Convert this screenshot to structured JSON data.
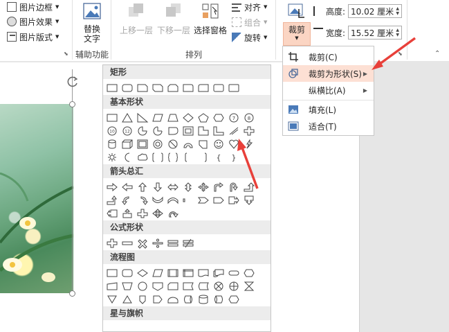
{
  "ribbon": {
    "picture_styles": [
      "图片边框",
      "图片效果",
      "图片版式"
    ],
    "alt_text_label": "替换\n文字",
    "aux_group_label": "辅助功能",
    "bring_forward": "上移一层",
    "send_backward": "下移一层",
    "selection_pane": "选择窗格",
    "align": "对齐",
    "group": "组合",
    "rotate": "旋转",
    "arrange_group_label": "排列",
    "crop_label": "裁剪",
    "height_label": "高度:",
    "height_value": "10.02 厘米",
    "width_label": "宽度:",
    "width_value": "15.52 厘米"
  },
  "crop_menu": {
    "items": [
      {
        "label": "裁剪(C)",
        "icon": "crop-icon"
      },
      {
        "label": "裁剪为形状(S)",
        "icon": "crop-to-shape-icon",
        "submenu": true
      },
      {
        "label": "纵横比(A)",
        "icon": "",
        "submenu": true
      },
      {
        "label": "填充(L)",
        "icon": "fill-icon"
      },
      {
        "label": "适合(T)",
        "icon": "fit-icon"
      }
    ]
  },
  "gallery": {
    "categories": [
      "矩形",
      "基本形状",
      "箭头总汇",
      "公式形状",
      "流程图",
      "星与旗帜"
    ],
    "number_shapes": [
      "7",
      "8",
      "10",
      "12"
    ],
    "brace_glyphs": [
      "{",
      "}"
    ]
  },
  "colors": {
    "crop_button_bg": "#fbd5c3",
    "menu_highlight": "#fde0d4",
    "annotation_arrow": "#e8403a"
  }
}
